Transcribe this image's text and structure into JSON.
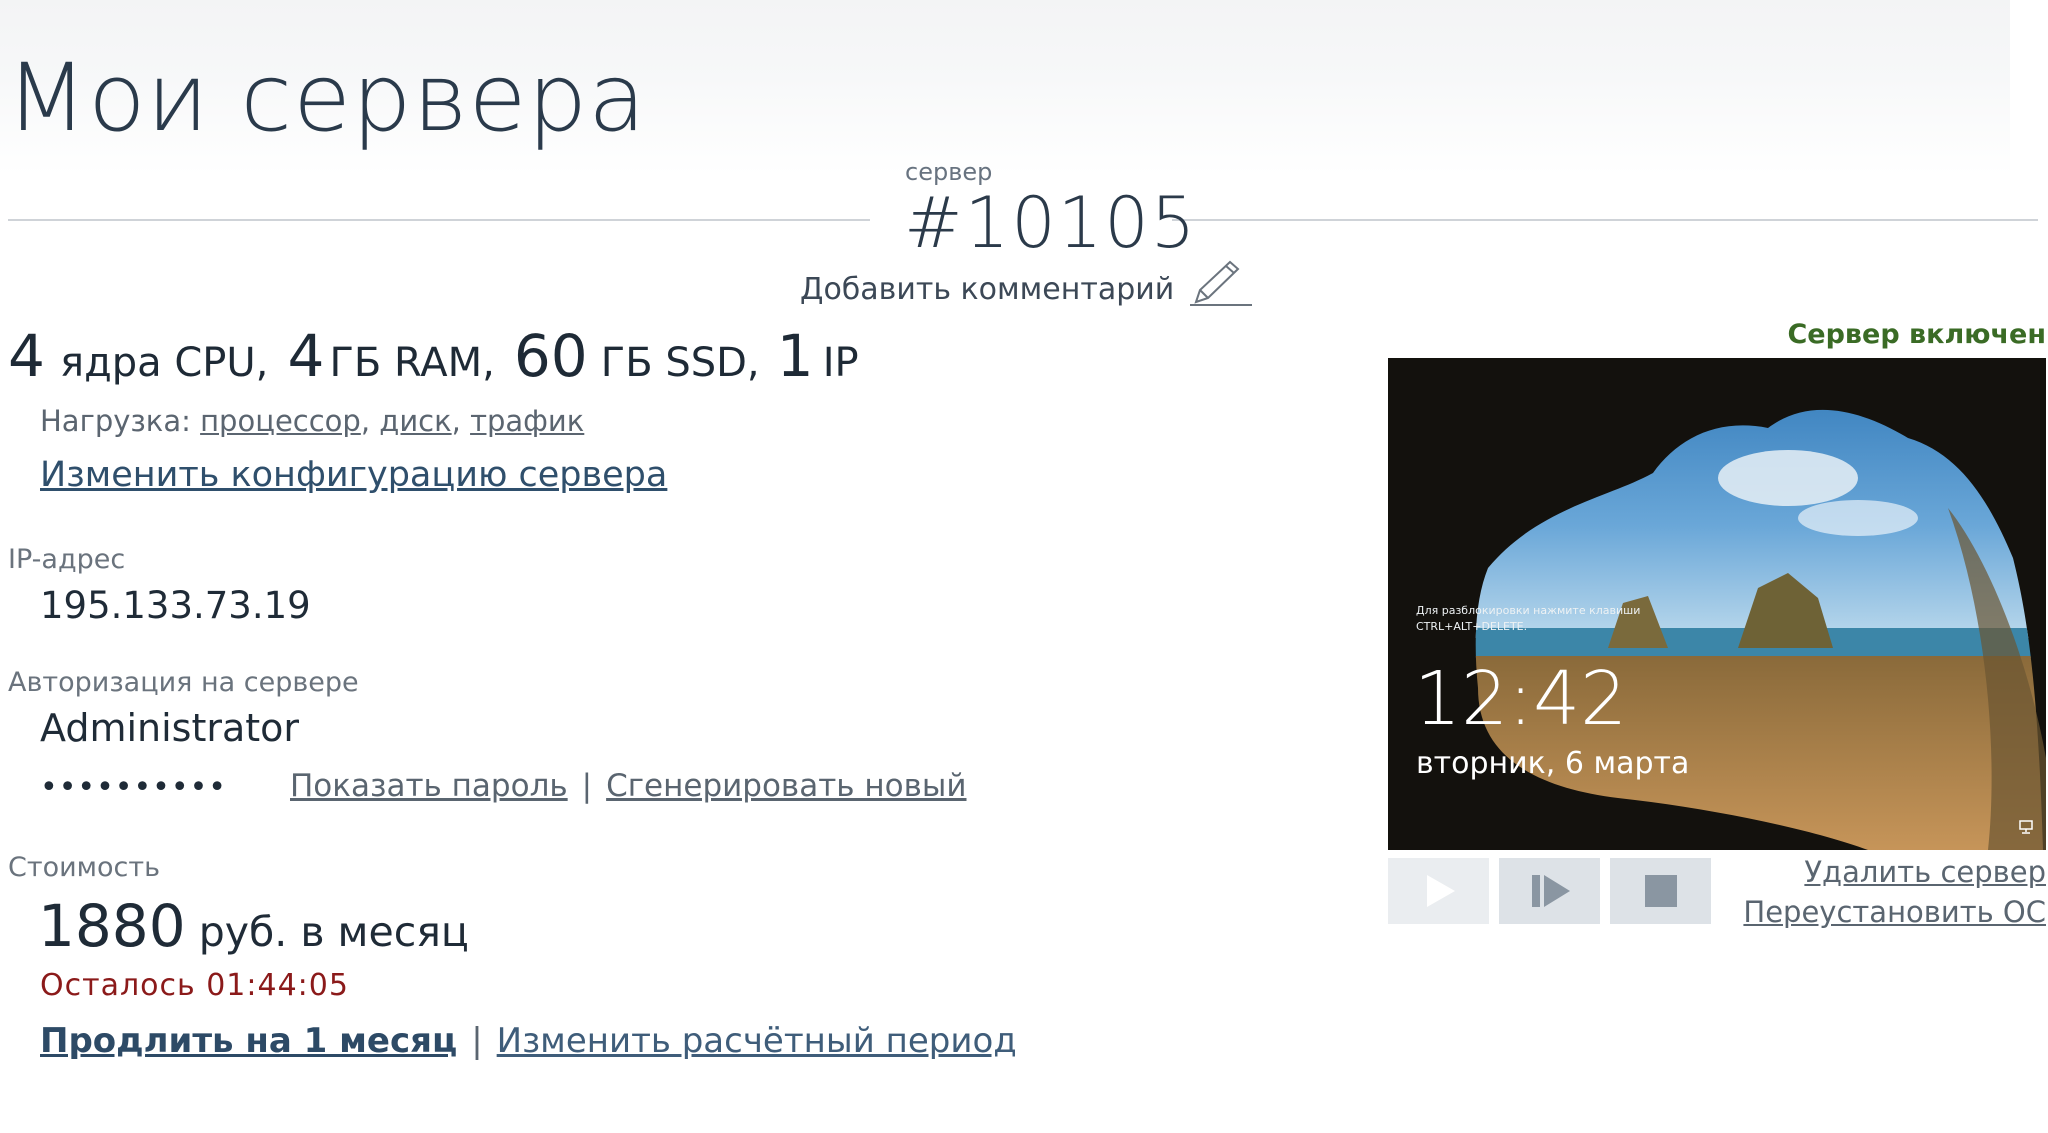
{
  "header": {
    "title": "Мои сервера"
  },
  "server": {
    "caption": "сервер",
    "id": "#10105",
    "add_comment": "Добавить комментарий",
    "specs": [
      {
        "value": "4",
        "unit": "ядра CPU,"
      },
      {
        "value": "4",
        "unit": "ГБ RAM,"
      },
      {
        "value": "60",
        "unit": "ГБ SSD,"
      },
      {
        "value": "1",
        "unit": "IP"
      }
    ],
    "load": {
      "label": "Нагрузка:",
      "links": [
        "процессор",
        "диск",
        "трафик"
      ]
    },
    "change_config": "Изменить конфигурацию сервера"
  },
  "ip": {
    "label": "IP-адрес",
    "value": "195.133.73.19"
  },
  "auth": {
    "label": "Авторизация на сервере",
    "user": "Administrator",
    "password_mask": "••••••••••",
    "show_password": "Показать пароль",
    "separator": "|",
    "generate_new": "Сгенерировать новый"
  },
  "cost": {
    "label": "Стоимость",
    "amount": "1880",
    "unit": "руб. в месяц",
    "remaining": "Осталось 01:44:05",
    "extend": "Продлить на 1 месяц",
    "separator": "|",
    "change_period": "Изменить расчётный период"
  },
  "status": {
    "text": "Сервер включен",
    "color": "#3a6b25"
  },
  "screen": {
    "hint_line1": "Для разблокировки нажмите клавиши",
    "hint_line2": "CTRL+ALT+DELETE.",
    "time": "12:42",
    "date": "вторник, 6 марта"
  },
  "controls": {
    "buttons": [
      {
        "name": "play-icon"
      },
      {
        "name": "step-forward-icon"
      },
      {
        "name": "stop-icon"
      }
    ]
  },
  "manage": {
    "delete": "Удалить сервер",
    "reinstall": "Переустановить ОС"
  }
}
